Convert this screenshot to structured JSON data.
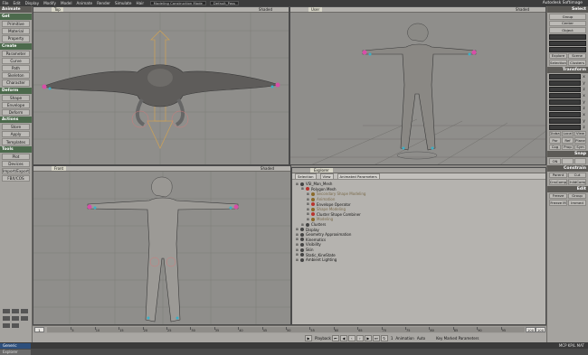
{
  "menubar": {
    "items": [
      "File",
      "Edit",
      "Display",
      "Modify",
      "Model",
      "Animate",
      "Render",
      "Simulate",
      "Hair"
    ],
    "mode_dropdown": "Modeling Construction Mode",
    "scene_dropdown": "Default_Pass",
    "app_title": "Autodesk Softimage"
  },
  "left_toolbar": {
    "header": "Animate",
    "sections": [
      {
        "title": "Get",
        "buttons": [
          "Primitive",
          "Material",
          "Property"
        ]
      },
      {
        "title": "Create",
        "buttons": [
          "Parameter",
          "Curve",
          "Path",
          "Skeleton",
          "Character"
        ]
      },
      {
        "title": "Deform",
        "buttons": [
          "Shape",
          "Envelope",
          "Deform"
        ]
      },
      {
        "title": "Actions",
        "buttons": [
          "Store",
          "Apply",
          "Templates"
        ]
      },
      {
        "title": "Tools",
        "buttons": [
          "Plot",
          "Devices",
          "Import/Export",
          "FBX/COS"
        ]
      }
    ]
  },
  "viewports": {
    "top": {
      "label": "Top",
      "mode": "Shaded"
    },
    "user": {
      "label": "User",
      "mode": "Shaded"
    },
    "front": {
      "label": "Front",
      "mode": "Shaded"
    }
  },
  "explorer": {
    "label": "Explorer",
    "toolbar": [
      "Selection",
      "View",
      "Animated Parameters"
    ],
    "tree": [
      {
        "text": "VSI_Man_Mesh",
        "indent": 0,
        "color": "#444"
      },
      {
        "text": "Polygon Mesh",
        "indent": 1,
        "color": "#b8342e"
      },
      {
        "text": "Secondary Shape Modeling",
        "indent": 2,
        "color": "#8a6a2a",
        "muted": true
      },
      {
        "text": "Animation",
        "indent": 2,
        "color": "#8a6a2a",
        "muted": true
      },
      {
        "text": "Envelope Operator",
        "indent": 2,
        "color": "#b8342e"
      },
      {
        "text": "Shape Modeling",
        "indent": 2,
        "color": "#8a6a2a",
        "muted": true
      },
      {
        "text": "Cluster Shape Combiner",
        "indent": 2,
        "color": "#b8342e"
      },
      {
        "text": "Modeling",
        "indent": 2,
        "color": "#8a6a2a",
        "muted": true
      },
      {
        "text": "Clusters",
        "indent": 1,
        "color": "#444"
      },
      {
        "text": "Display",
        "indent": 0,
        "color": "#444"
      },
      {
        "text": "Geometry Approximation",
        "indent": 0,
        "color": "#444"
      },
      {
        "text": "Kinematics",
        "indent": 0,
        "color": "#444"
      },
      {
        "text": "Visibility",
        "indent": 0,
        "color": "#444"
      },
      {
        "text": "Skin",
        "indent": 0,
        "color": "#444"
      },
      {
        "text": "Static_KineState",
        "indent": 0,
        "color": "#444"
      },
      {
        "text": "Ambient Lighting",
        "indent": 0,
        "color": "#444"
      }
    ]
  },
  "timeline": {
    "start": "1",
    "end": "100",
    "current": "100",
    "ticks": [
      "5",
      "10",
      "15",
      "20",
      "25",
      "30",
      "35",
      "40",
      "45",
      "50",
      "55",
      "60",
      "65",
      "70",
      "75",
      "80",
      "85",
      "90",
      "95"
    ]
  },
  "playback": {
    "playback_label": "Playback",
    "animation_label": "Animation",
    "auto_label": "Auto",
    "key_label": "Key Marked Parameters",
    "frame": "1"
  },
  "statusbar": {
    "left": "Generic",
    "right": "MCP  KP/L  MAT"
  },
  "cmdbar": {
    "left": "Explorer"
  },
  "right_panel": {
    "select": {
      "title": "Select",
      "buttons": [
        "Group",
        "Center",
        "Object"
      ],
      "row": [
        "Explore",
        "Scene"
      ],
      "row2": [
        "Selection",
        "Clusters"
      ]
    },
    "transform": {
      "title": "Transform",
      "axes": [
        "x",
        "y",
        "z"
      ],
      "row": [
        "Global",
        "Local",
        "View"
      ],
      "row2": [
        "Par",
        "Ref",
        "Plane"
      ],
      "row3": [
        "Cog",
        "Prop",
        "Sym"
      ]
    },
    "snap": {
      "title": "Snap",
      "row": [
        "ON",
        "",
        ""
      ]
    },
    "constrain": {
      "title": "Constrain",
      "row": [
        "Parent",
        "Cut"
      ],
      "row2": [
        "CnsComp",
        "ChildComp"
      ]
    },
    "edit": {
      "title": "Edit",
      "row": [
        "Freeze",
        "Group"
      ],
      "row2": [
        "Freeze M",
        "Immed"
      ]
    }
  }
}
